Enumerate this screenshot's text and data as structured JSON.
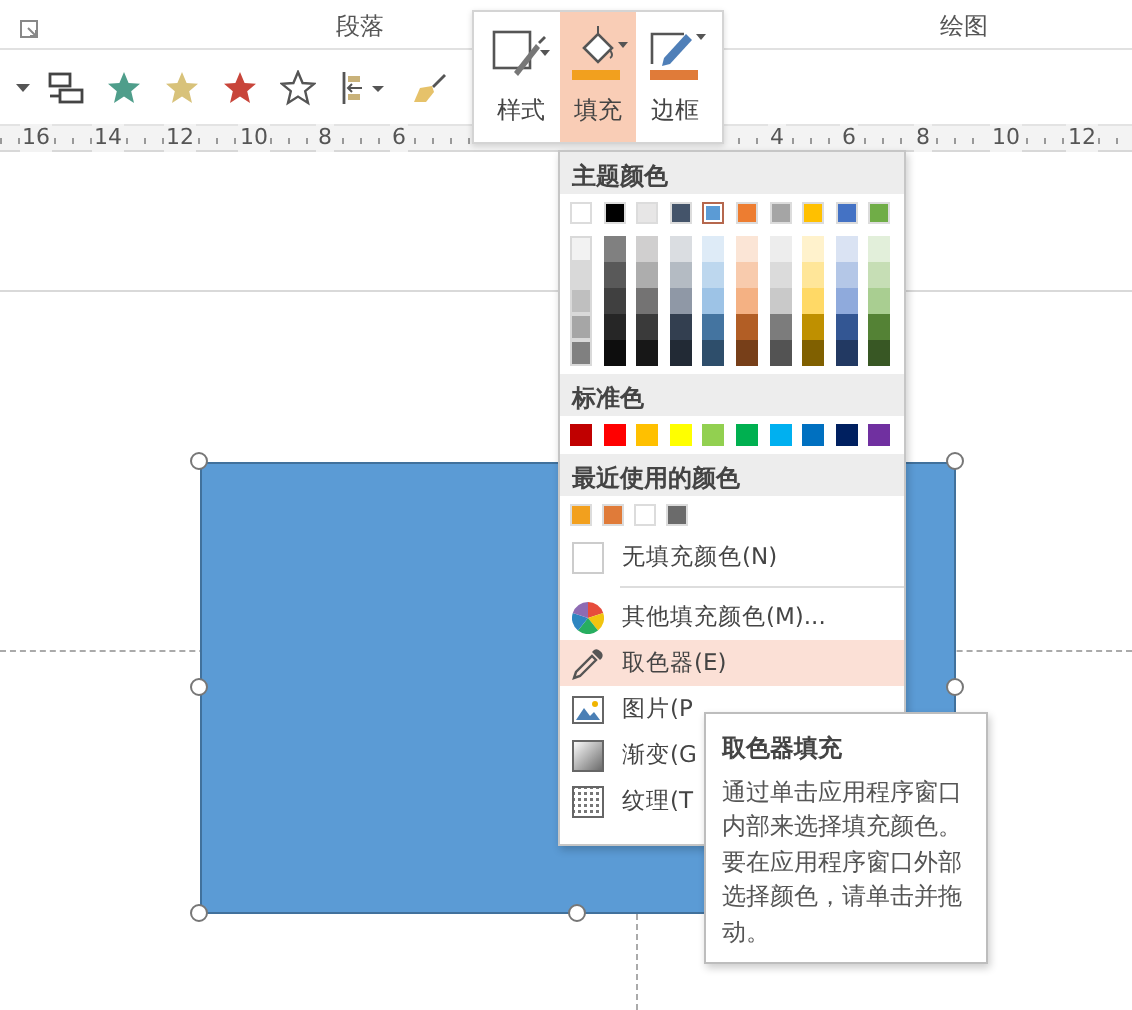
{
  "ribbon": {
    "group_labels": [
      "段落",
      "绘图"
    ],
    "toolbar_icons": [
      {
        "kind": "caret"
      },
      {
        "kind": "arrange"
      },
      {
        "kind": "star",
        "color": "#4f9e8b"
      },
      {
        "kind": "star",
        "color": "#d8c27a"
      },
      {
        "kind": "star",
        "color": "#c8453a"
      },
      {
        "kind": "star-outline"
      },
      {
        "kind": "align"
      },
      {
        "kind": "brush"
      }
    ]
  },
  "ruler": {
    "left_ticks": [
      "16",
      "14",
      "12",
      "10",
      "8",
      "6"
    ],
    "right_ticks": [
      "4",
      "6",
      "8",
      "10",
      "12"
    ]
  },
  "shape_buttons": [
    {
      "kind": "style",
      "label": "样式",
      "selected": false
    },
    {
      "kind": "fill",
      "label": "填充",
      "selected": true,
      "color": "#f2a01e"
    },
    {
      "kind": "outline",
      "label": "边框",
      "selected": false,
      "color": "#e07b39"
    }
  ],
  "fill_menu": {
    "theme_header": "主题颜色",
    "theme_colors": [
      {
        "color": "#ffffff",
        "selected": false
      },
      {
        "color": "#000000",
        "selected": false
      },
      {
        "color": "#e7e6e6",
        "selected": false
      },
      {
        "color": "#44546a",
        "selected": false
      },
      {
        "color": "#5b9bd5",
        "selected": true
      },
      {
        "color": "#ed7d31",
        "selected": false
      },
      {
        "color": "#a5a5a5",
        "selected": false
      },
      {
        "color": "#ffc000",
        "selected": false
      },
      {
        "color": "#4472c4",
        "selected": false
      },
      {
        "color": "#70ad47",
        "selected": false
      }
    ],
    "standard_header": "标准色",
    "standard_colors": [
      {
        "color": "#c00000"
      },
      {
        "color": "#ff0000"
      },
      {
        "color": "#ffc000"
      },
      {
        "color": "#ffff00"
      },
      {
        "color": "#92d050"
      },
      {
        "color": "#00b050"
      },
      {
        "color": "#00b0f0"
      },
      {
        "color": "#0070c0"
      },
      {
        "color": "#002060"
      },
      {
        "color": "#7030a0"
      }
    ],
    "recent_header": "最近使用的颜色",
    "recent_colors": [
      {
        "color": "#f2a01e"
      },
      {
        "color": "#e07b39"
      },
      {
        "color": "#ffffff"
      },
      {
        "color": "#6b6b6b"
      }
    ],
    "items": [
      {
        "kind": "none",
        "label": "无填充颜色(N)",
        "selected": false
      },
      {
        "kind": "more",
        "label": "其他填充颜色(M)...",
        "selected": false
      },
      {
        "kind": "eyedropper",
        "label": "取色器(E)",
        "selected": true
      },
      {
        "kind": "picture",
        "label": "图片(P",
        "selected": false
      },
      {
        "kind": "gradient",
        "label": "渐变(G",
        "selected": false
      },
      {
        "kind": "texture",
        "label": "纹理(T",
        "selected": false
      }
    ]
  },
  "tooltip": {
    "title": "取色器填充",
    "text": "通过单击应用程序窗口内部来选择填充颜色。要在应用程序窗口外部选择颜色，请单击并拖动。"
  }
}
